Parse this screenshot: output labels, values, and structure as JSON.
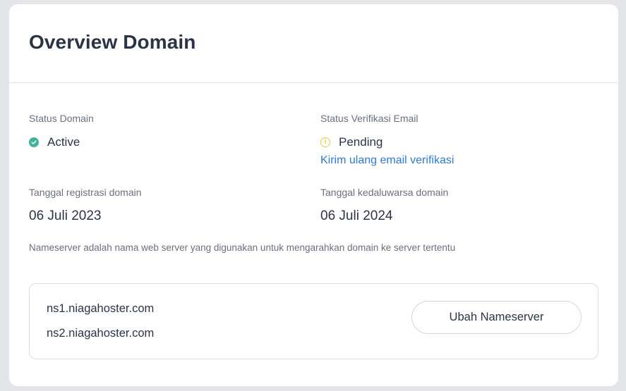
{
  "card": {
    "title": "Overview Domain"
  },
  "status_domain": {
    "label": "Status Domain",
    "value": "Active",
    "icon": "check-circle-icon",
    "color": "#3eb39e"
  },
  "status_email": {
    "label": "Status Verifikasi Email",
    "value": "Pending",
    "icon": "info-circle-icon",
    "color": "#f2c53d",
    "resend_link": "Kirim ulang email verifikasi"
  },
  "registration": {
    "label": "Tanggal registrasi domain",
    "date": "06 Juli 2023"
  },
  "expiry": {
    "label": "Tanggal kedaluwarsa domain",
    "date": "06 Juli 2024"
  },
  "nameserver": {
    "description": "Nameserver adalah nama web server yang digunakan untuk mengarahkan domain ke server tertentu",
    "servers": [
      "ns1.niagahoster.com",
      "ns2.niagahoster.com"
    ],
    "change_button": "Ubah Nameserver"
  },
  "colors": {
    "link": "#2a7ed3",
    "text_primary": "#2b3447",
    "text_secondary": "#6a7080"
  }
}
